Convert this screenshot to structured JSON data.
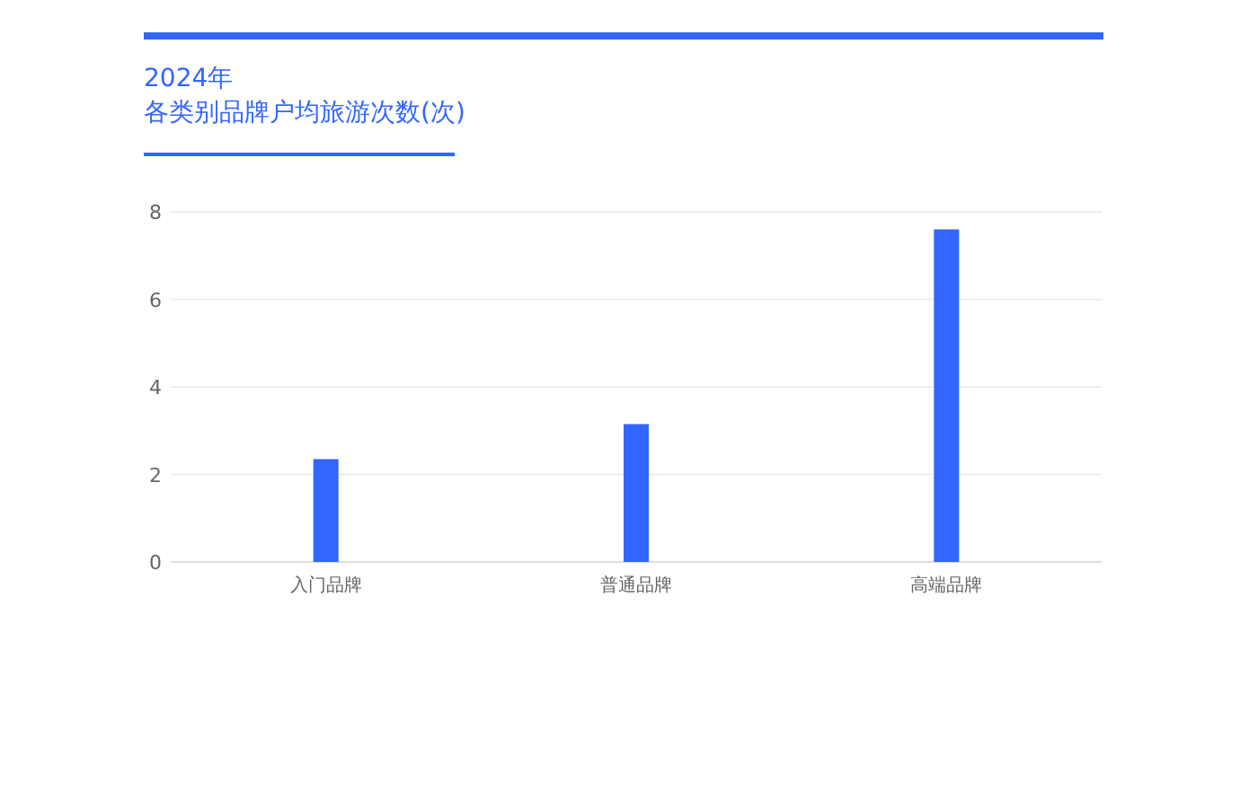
{
  "header": {
    "year": "2024年",
    "title": "各类别品牌户均旅游次数(次)"
  },
  "chart": {
    "chart_data": {
      "type": "bar",
      "categories": [
        "入门品牌",
        "普通品牌",
        "高端品牌"
      ],
      "series": [
        {
          "color": "#3366ff",
          "values": [
            2.35,
            3.15,
            7.6
          ]
        }
      ],
      "ylim": [
        0,
        8
      ],
      "yticks": [
        0,
        2,
        4,
        6,
        8
      ],
      "grid": true
    }
  }
}
